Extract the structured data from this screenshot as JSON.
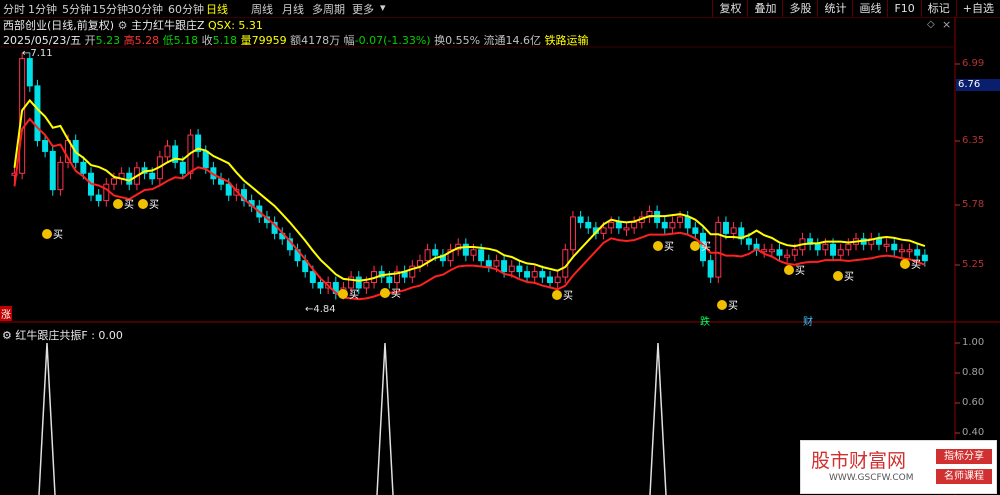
{
  "toolbar": {
    "periods": [
      "分时",
      "1分钟",
      "5分钟",
      "15分钟",
      "30分钟",
      "60分钟",
      "日线",
      "周线",
      "月线",
      "多周期",
      "更多"
    ],
    "active_period": "日线",
    "right_buttons": [
      "复权",
      "叠加",
      "多股",
      "统计",
      "画线",
      "F10",
      "标记",
      "+自选"
    ]
  },
  "header": {
    "stock_name": "西部创业(日线,前复权)",
    "indicator_name": "主力红牛跟庄Z",
    "qsx_label": "QSX: 5.31",
    "date": "2025/05/23/五",
    "open_label": "开",
    "open": "5.23",
    "high_label": "高",
    "high": "5.28",
    "low_label": "低",
    "low": "5.18",
    "close_label": "收",
    "close": "5.18",
    "volume_label": "量",
    "volume": "79959",
    "amount_label": "额",
    "amount": "4178万",
    "change_label": "幅",
    "change": "-0.07(-1.33%)",
    "turnover_label": "换",
    "turnover": "0.55%",
    "float_label": "流通",
    "float": "14.6亿",
    "industry": "铁路运输"
  },
  "price_axis": [
    "6.99",
    "6.35",
    "5.78",
    "5.25"
  ],
  "current_price_tag": "6.76",
  "annotations": {
    "high_marker": "7.11",
    "low_marker": "4.84",
    "buy_label": "买",
    "die_label": "跌",
    "cai_label": "财",
    "zhang_label": "涨"
  },
  "indicator": {
    "title": "红牛跟庄共振F : 0.00",
    "axis": [
      "1.00",
      "0.80",
      "0.60",
      "0.40"
    ]
  },
  "watermark": {
    "main": "股市财富网",
    "url": "WWW.GSCFW.COM",
    "tag1": "指标分享",
    "tag2": "名师课程"
  },
  "colors": {
    "up": "#ff3250",
    "down": "#00e0e8",
    "ma_yellow": "#ffff00",
    "ma_red": "#ff2020",
    "buy_marker": "#f0c000"
  }
}
